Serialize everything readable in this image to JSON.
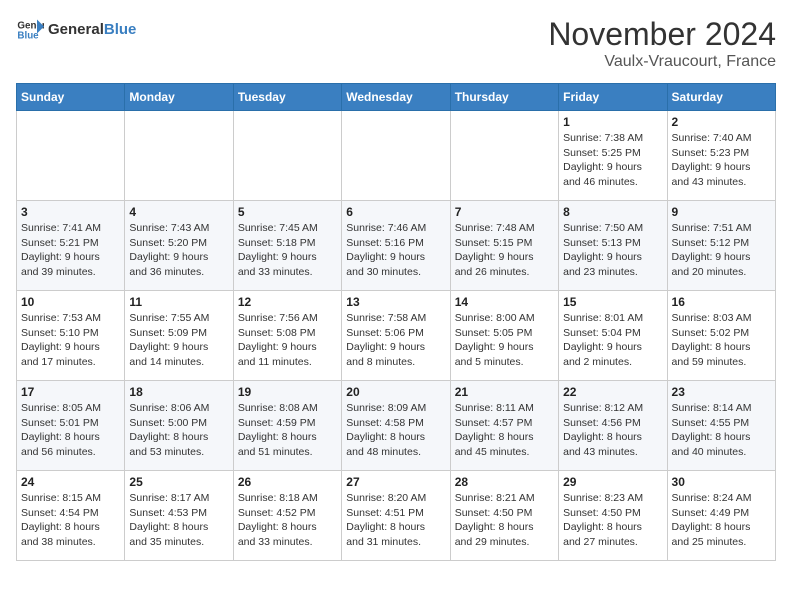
{
  "logo": {
    "general": "General",
    "blue": "Blue"
  },
  "title": {
    "month": "November 2024",
    "location": "Vaulx-Vraucourt, France"
  },
  "headers": [
    "Sunday",
    "Monday",
    "Tuesday",
    "Wednesday",
    "Thursday",
    "Friday",
    "Saturday"
  ],
  "weeks": [
    [
      {
        "day": "",
        "info": ""
      },
      {
        "day": "",
        "info": ""
      },
      {
        "day": "",
        "info": ""
      },
      {
        "day": "",
        "info": ""
      },
      {
        "day": "",
        "info": ""
      },
      {
        "day": "1",
        "info": "Sunrise: 7:38 AM\nSunset: 5:25 PM\nDaylight: 9 hours\nand 46 minutes."
      },
      {
        "day": "2",
        "info": "Sunrise: 7:40 AM\nSunset: 5:23 PM\nDaylight: 9 hours\nand 43 minutes."
      }
    ],
    [
      {
        "day": "3",
        "info": "Sunrise: 7:41 AM\nSunset: 5:21 PM\nDaylight: 9 hours\nand 39 minutes."
      },
      {
        "day": "4",
        "info": "Sunrise: 7:43 AM\nSunset: 5:20 PM\nDaylight: 9 hours\nand 36 minutes."
      },
      {
        "day": "5",
        "info": "Sunrise: 7:45 AM\nSunset: 5:18 PM\nDaylight: 9 hours\nand 33 minutes."
      },
      {
        "day": "6",
        "info": "Sunrise: 7:46 AM\nSunset: 5:16 PM\nDaylight: 9 hours\nand 30 minutes."
      },
      {
        "day": "7",
        "info": "Sunrise: 7:48 AM\nSunset: 5:15 PM\nDaylight: 9 hours\nand 26 minutes."
      },
      {
        "day": "8",
        "info": "Sunrise: 7:50 AM\nSunset: 5:13 PM\nDaylight: 9 hours\nand 23 minutes."
      },
      {
        "day": "9",
        "info": "Sunrise: 7:51 AM\nSunset: 5:12 PM\nDaylight: 9 hours\nand 20 minutes."
      }
    ],
    [
      {
        "day": "10",
        "info": "Sunrise: 7:53 AM\nSunset: 5:10 PM\nDaylight: 9 hours\nand 17 minutes."
      },
      {
        "day": "11",
        "info": "Sunrise: 7:55 AM\nSunset: 5:09 PM\nDaylight: 9 hours\nand 14 minutes."
      },
      {
        "day": "12",
        "info": "Sunrise: 7:56 AM\nSunset: 5:08 PM\nDaylight: 9 hours\nand 11 minutes."
      },
      {
        "day": "13",
        "info": "Sunrise: 7:58 AM\nSunset: 5:06 PM\nDaylight: 9 hours\nand 8 minutes."
      },
      {
        "day": "14",
        "info": "Sunrise: 8:00 AM\nSunset: 5:05 PM\nDaylight: 9 hours\nand 5 minutes."
      },
      {
        "day": "15",
        "info": "Sunrise: 8:01 AM\nSunset: 5:04 PM\nDaylight: 9 hours\nand 2 minutes."
      },
      {
        "day": "16",
        "info": "Sunrise: 8:03 AM\nSunset: 5:02 PM\nDaylight: 8 hours\nand 59 minutes."
      }
    ],
    [
      {
        "day": "17",
        "info": "Sunrise: 8:05 AM\nSunset: 5:01 PM\nDaylight: 8 hours\nand 56 minutes."
      },
      {
        "day": "18",
        "info": "Sunrise: 8:06 AM\nSunset: 5:00 PM\nDaylight: 8 hours\nand 53 minutes."
      },
      {
        "day": "19",
        "info": "Sunrise: 8:08 AM\nSunset: 4:59 PM\nDaylight: 8 hours\nand 51 minutes."
      },
      {
        "day": "20",
        "info": "Sunrise: 8:09 AM\nSunset: 4:58 PM\nDaylight: 8 hours\nand 48 minutes."
      },
      {
        "day": "21",
        "info": "Sunrise: 8:11 AM\nSunset: 4:57 PM\nDaylight: 8 hours\nand 45 minutes."
      },
      {
        "day": "22",
        "info": "Sunrise: 8:12 AM\nSunset: 4:56 PM\nDaylight: 8 hours\nand 43 minutes."
      },
      {
        "day": "23",
        "info": "Sunrise: 8:14 AM\nSunset: 4:55 PM\nDaylight: 8 hours\nand 40 minutes."
      }
    ],
    [
      {
        "day": "24",
        "info": "Sunrise: 8:15 AM\nSunset: 4:54 PM\nDaylight: 8 hours\nand 38 minutes."
      },
      {
        "day": "25",
        "info": "Sunrise: 8:17 AM\nSunset: 4:53 PM\nDaylight: 8 hours\nand 35 minutes."
      },
      {
        "day": "26",
        "info": "Sunrise: 8:18 AM\nSunset: 4:52 PM\nDaylight: 8 hours\nand 33 minutes."
      },
      {
        "day": "27",
        "info": "Sunrise: 8:20 AM\nSunset: 4:51 PM\nDaylight: 8 hours\nand 31 minutes."
      },
      {
        "day": "28",
        "info": "Sunrise: 8:21 AM\nSunset: 4:50 PM\nDaylight: 8 hours\nand 29 minutes."
      },
      {
        "day": "29",
        "info": "Sunrise: 8:23 AM\nSunset: 4:50 PM\nDaylight: 8 hours\nand 27 minutes."
      },
      {
        "day": "30",
        "info": "Sunrise: 8:24 AM\nSunset: 4:49 PM\nDaylight: 8 hours\nand 25 minutes."
      }
    ]
  ]
}
